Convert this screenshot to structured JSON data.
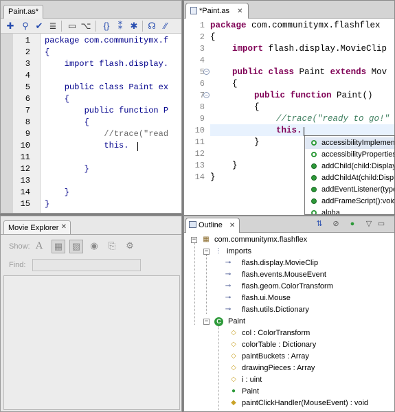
{
  "left_editor": {
    "tab_label": "Paint.as*",
    "line_numbers": [
      "1",
      "2",
      "3",
      "4",
      "5",
      "6",
      "7",
      "8",
      "9",
      "10",
      "11",
      "12",
      "13",
      "14",
      "15"
    ],
    "lines": [
      "package com.communitymx.f",
      "{",
      "    import flash.display.",
      "",
      "    public class Paint ex",
      "    {",
      "        public function P",
      "        {",
      "            //trace(\"read",
      "            this.",
      "",
      "        }",
      "",
      "    }",
      "}"
    ]
  },
  "movie_explorer": {
    "tab_label": "Movie Explorer",
    "show_label": "Show:",
    "find_label": "Find:",
    "find_value": ""
  },
  "right_editor": {
    "tab_label": "*Paint.as",
    "line_numbers": [
      "1",
      "2",
      "3",
      "4",
      "5",
      "6",
      "7",
      "8",
      "9",
      "10",
      "11",
      "12",
      "13",
      "14"
    ],
    "lines": {
      "l1_kw": "package",
      "l1_rest": " com.communitymx.flashflex",
      "l2": "{",
      "l3_kw": "import",
      "l3_rest": " flash.display.MovieClip",
      "l5_kw1": "public",
      "l5_kw2": "class",
      "l5_mid": " Paint ",
      "l5_kw3": "extends",
      "l5_rest": " Mov",
      "l6": "{",
      "l7_kw1": "public",
      "l7_kw2": "function",
      "l7_rest": " Paint()",
      "l8": "{",
      "l9_cmt": "//trace(\"ready to go!\"",
      "l10_kw": "this.",
      "l11": "}",
      "l13": "}",
      "l14": "}"
    }
  },
  "autocomplete": {
    "items": [
      "accessibilityImplementat",
      "accessibilityProperties",
      "addChild(child:DisplayO",
      "addChildAt(child:Displa",
      "addEventListener(type",
      "addFrameScript():void",
      "alpha"
    ]
  },
  "outline": {
    "tab_label": "Outline",
    "package": "com.communitymx.flashflex",
    "imports_label": "imports",
    "imports": [
      "flash.display.MovieClip",
      "flash.events.MouseEvent",
      "flash.geom.ColorTransform",
      "flash.ui.Mouse",
      "flash.utils.Dictionary"
    ],
    "class_label": "Paint",
    "members": [
      "col : ColorTransform",
      "colorTable : Dictionary",
      "paintBuckets : Array",
      "drawingPieces : Array",
      "i : uint",
      "Paint",
      "paintClickHandler(MouseEvent) : void"
    ]
  },
  "colors": {
    "keyword": "#7f0055",
    "comment": "#3f7f5f",
    "flash_code": "#00008b",
    "method_dot": "#2e9a3a"
  }
}
